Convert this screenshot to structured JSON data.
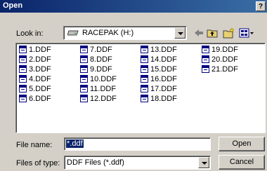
{
  "window": {
    "title": "Open",
    "help_label": "?"
  },
  "look_in": {
    "label": "Look in:",
    "value": "RACEPAK (H:)",
    "drive_icon": "drive-icon"
  },
  "toolbar": {
    "icons": [
      "back-icon",
      "up-folder-icon",
      "new-folder-icon",
      "views-menu-icon"
    ]
  },
  "files": [
    "1.DDF",
    "2.DDF",
    "3.DDF",
    "4.DDF",
    "5.DDF",
    "6.DDF",
    "7.DDF",
    "8.DDF",
    "9.DDF",
    "10.DDF",
    "11.DDF",
    "12.DDF",
    "13.DDF",
    "14.DDF",
    "15.DDF",
    "16.DDF",
    "17.DDF",
    "18.DDF",
    "19.DDF",
    "20.DDF",
    "21.DDF"
  ],
  "file_name": {
    "label": "File name:",
    "value": "*.ddf"
  },
  "file_type": {
    "label": "Files of type:",
    "value": "DDF Files (*.ddf)"
  },
  "buttons": {
    "open": "Open",
    "cancel": "Cancel"
  },
  "colors": {
    "title_bar": "#0a246a",
    "face": "#d4d0c8",
    "selection": "#0a246a"
  }
}
